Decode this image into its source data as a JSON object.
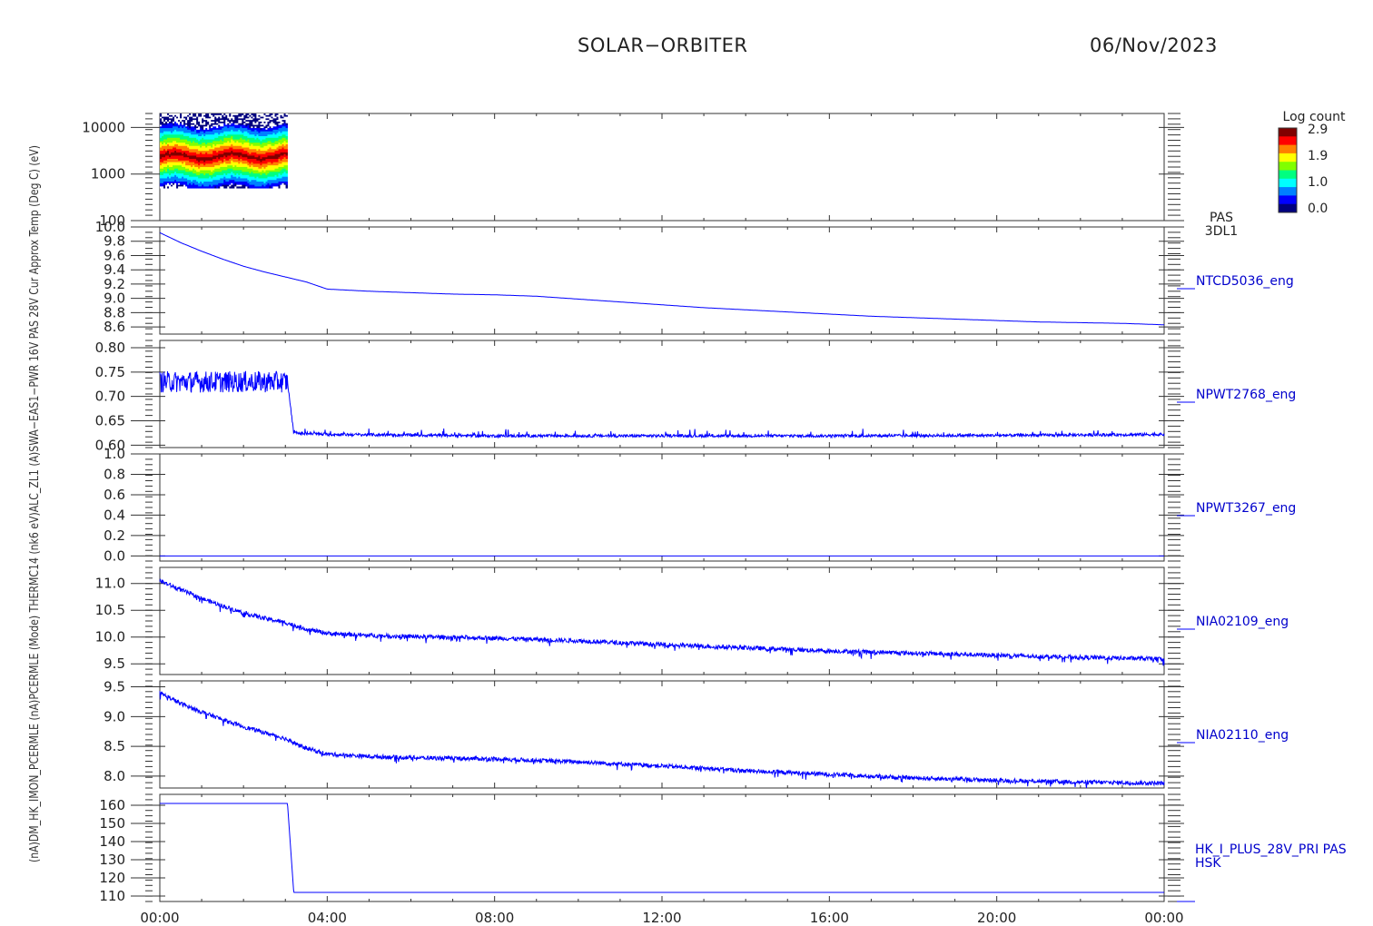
{
  "header": {
    "title": "SOLAR−ORBITER",
    "date": "06/Nov/2023"
  },
  "colorbar": {
    "title": "Log count",
    "ticks": [
      "2.9",
      "1.9",
      "1.0",
      "0.0"
    ],
    "colors": [
      "#00007f",
      "#0000ff",
      "#0080ff",
      "#00ffff",
      "#00ff80",
      "#80ff00",
      "#ffff00",
      "#ff8000",
      "#ff0000",
      "#800000"
    ]
  },
  "left_axis_label": "(nA)DM_HK_IMON_PCERMLE (nA)PCERMLE (Mode) THERMC14 (nk6 eV)ALC_ZL1 (A)SWA−EAS1−PWR 16V PAS 28V Cur Approx Temp (Deg C) (eV)",
  "chart_data": {
    "type": "line",
    "line_color": "#0000ff",
    "x_label_ticks": [
      "00:00",
      "04:00",
      "08:00",
      "12:00",
      "16:00",
      "20:00",
      "00:00"
    ],
    "x_range_hours": [
      0,
      24
    ],
    "panels": [
      {
        "id": "PAS 3DL1",
        "type": "heatmap",
        "label": "PAS",
        "label2": "3DL1",
        "ylog": true,
        "ylim": [
          100,
          20000
        ],
        "yticks": [
          "10000",
          "1000",
          "100"
        ],
        "ytick_values": [
          10000,
          1000,
          100
        ],
        "data_hours": [
          0.0,
          3.05
        ],
        "peak_energy_ev": 2400,
        "energy_range_ev": [
          500,
          20000
        ]
      },
      {
        "id": "NTCD5036_eng",
        "label": "NTCD5036_eng",
        "ylim": [
          8.5,
          10.0
        ],
        "yticks": [
          "10.0",
          "9.8",
          "9.6",
          "9.4",
          "9.2",
          "9.0",
          "8.8",
          "8.6"
        ],
        "ytick_values": [
          10.0,
          9.8,
          9.6,
          9.4,
          9.2,
          9.0,
          8.8,
          8.6
        ],
        "x": [
          0,
          0.5,
          1,
          1.5,
          2,
          2.5,
          3,
          3.5,
          4,
          5,
          6,
          7,
          8,
          9,
          10,
          11,
          12,
          13,
          14,
          15,
          16,
          17,
          18,
          19,
          20,
          21,
          22,
          23,
          24
        ],
        "y": [
          9.92,
          9.78,
          9.66,
          9.55,
          9.45,
          9.37,
          9.3,
          9.23,
          9.13,
          9.1,
          9.08,
          9.06,
          9.05,
          9.03,
          8.99,
          8.95,
          8.91,
          8.87,
          8.84,
          8.81,
          8.78,
          8.75,
          8.73,
          8.71,
          8.69,
          8.67,
          8.66,
          8.65,
          8.63
        ],
        "noise": 0.0
      },
      {
        "id": "NPWT2768_eng",
        "label": "NPWT2768_eng",
        "ylim": [
          0.595,
          0.815
        ],
        "yticks": [
          "0.80",
          "0.75",
          "0.70",
          "0.65",
          "0.60"
        ],
        "ytick_values": [
          0.8,
          0.75,
          0.7,
          0.65,
          0.6
        ],
        "x": [
          0,
          3.05,
          3.2,
          4,
          8,
          12,
          16,
          20,
          24
        ],
        "y": [
          0.73,
          0.73,
          0.625,
          0.622,
          0.619,
          0.619,
          0.619,
          0.62,
          0.622
        ],
        "noise": 0.02,
        "spikes": true
      },
      {
        "id": "NPWT3267_eng",
        "label": "NPWT3267_eng",
        "ylim": [
          -0.05,
          1.0
        ],
        "yticks": [
          "1.0",
          "0.8",
          "0.6",
          "0.4",
          "0.2",
          "0.0"
        ],
        "ytick_values": [
          1.0,
          0.8,
          0.6,
          0.4,
          0.2,
          0.0
        ],
        "x": [
          0,
          24
        ],
        "y": [
          0.0,
          0.0
        ],
        "noise": 0.0
      },
      {
        "id": "NIA02109_eng",
        "label": "NIA02109_eng",
        "ylim": [
          9.3,
          11.3
        ],
        "yticks": [
          "11.0",
          "10.5",
          "10.0",
          "9.5"
        ],
        "ytick_values": [
          11.0,
          10.5,
          10.0,
          9.5
        ],
        "x": [
          0,
          0.5,
          1,
          1.5,
          2,
          2.5,
          3,
          3.5,
          4,
          5,
          6,
          8,
          10,
          12,
          14,
          16,
          18,
          20,
          22,
          24
        ],
        "y": [
          11.05,
          10.88,
          10.72,
          10.58,
          10.45,
          10.35,
          10.27,
          10.15,
          10.07,
          10.03,
          10.01,
          9.98,
          9.93,
          9.86,
          9.8,
          9.74,
          9.7,
          9.66,
          9.62,
          9.59
        ],
        "noise": 0.04
      },
      {
        "id": "NIA02110_eng",
        "label": "NIA02110_eng",
        "ylim": [
          7.8,
          9.6
        ],
        "yticks": [
          "9.5",
          "9.0",
          "8.5",
          "8.0"
        ],
        "ytick_values": [
          9.5,
          9.0,
          8.5,
          8.0
        ],
        "x": [
          0,
          0.5,
          1,
          1.5,
          2,
          2.5,
          3,
          3.5,
          4,
          5,
          6,
          8,
          10,
          12,
          14,
          16,
          18,
          20,
          22,
          24
        ],
        "y": [
          9.4,
          9.22,
          9.08,
          8.95,
          8.83,
          8.73,
          8.63,
          8.47,
          8.37,
          8.33,
          8.31,
          8.29,
          8.24,
          8.17,
          8.09,
          8.03,
          7.97,
          7.93,
          7.9,
          7.88
        ],
        "noise": 0.035
      },
      {
        "id": "HK_I_PLUS_28V_PRI PAS HSK",
        "label": "HK_I_PLUS_28V_PRI PAS",
        "label2": "HSK",
        "ylim": [
          107,
          166
        ],
        "yticks": [
          "160",
          "150",
          "140",
          "130",
          "120",
          "110"
        ],
        "ytick_values": [
          160,
          150,
          140,
          130,
          120,
          110
        ],
        "x": [
          0,
          3.05,
          3.2,
          24
        ],
        "y": [
          161.0,
          161.0,
          112.0,
          112.0
        ],
        "noise": 0.0
      }
    ]
  }
}
